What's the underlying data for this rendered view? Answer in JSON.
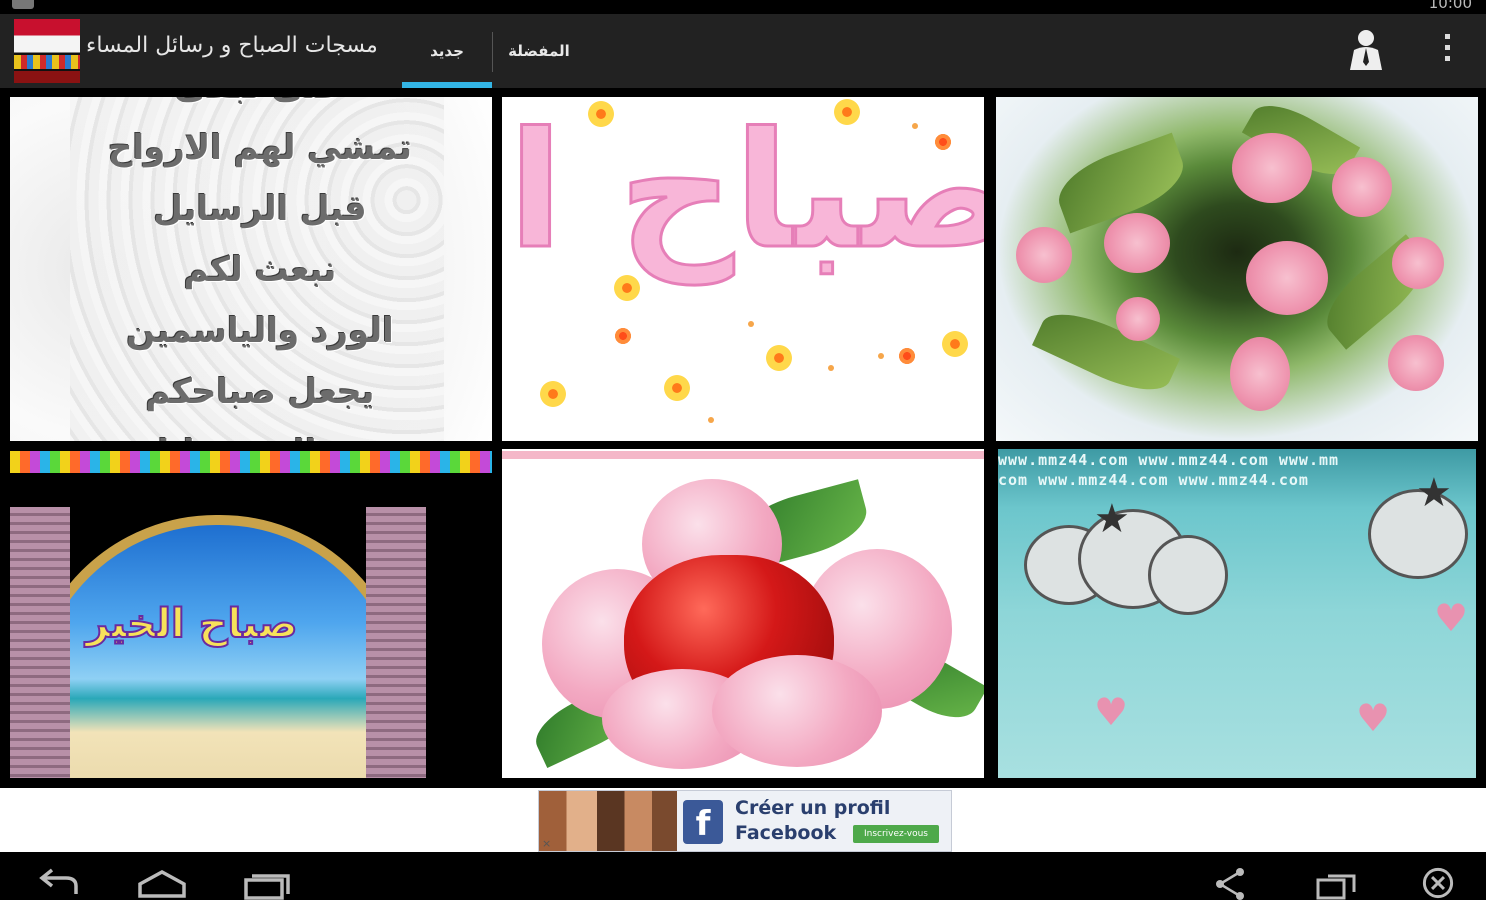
{
  "status_bar": {
    "clock": "10:00"
  },
  "action_bar": {
    "title": "مسجات الصباح و رسائل المساء",
    "tabs": [
      {
        "label": "جديد",
        "selected": true
      },
      {
        "label": "المفضلة",
        "selected": false
      }
    ],
    "icons": [
      "person-icon",
      "overflow-menu-icon"
    ],
    "accent_color": "#33b5e5"
  },
  "gallery": {
    "tiles": [
      {
        "lines": [
          "حتى تبقى",
          "تمشي لهم الارواح",
          "قبل الرسايل",
          "نبعث لكم",
          "الورد والياسمين",
          "يجعل صباحكم",
          "من الصبح نايل"
        ]
      },
      {
        "text": "صباح الخ"
      },
      {
        "text": ""
      },
      {
        "text": "صباح الخير"
      },
      {
        "text": ""
      },
      {
        "watermark_row1": "www.mmz44.com  www.mmz44.com  www.mm",
        "watermark_row2": "com  www.mmz44.com  www.mmz44.com"
      }
    ]
  },
  "ad": {
    "line1": "Créer un profil",
    "line2": "Facebook",
    "button": "Inscrivez-vous",
    "close": "×",
    "logo": "f"
  },
  "nav_bar": {
    "icons": [
      "back-icon",
      "home-icon",
      "recent-apps-icon",
      "share-icon",
      "screenshot-icon",
      "close-circle-icon"
    ]
  }
}
